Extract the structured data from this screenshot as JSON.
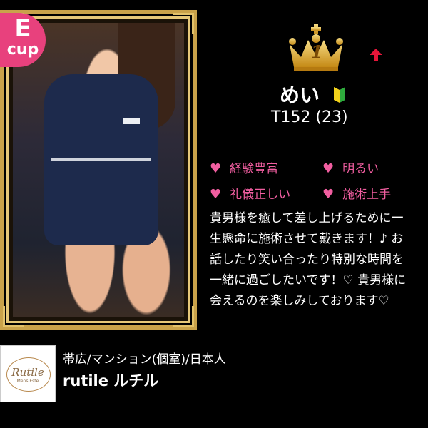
{
  "profile": {
    "cup": {
      "letter": "E",
      "unit": "cup"
    },
    "rank": {
      "number": "1",
      "trend": "up"
    },
    "name": "めい",
    "stats": "T152 (23)",
    "tags": [
      "経験豊富",
      "明るい",
      "礼儀正しい",
      "施術上手"
    ],
    "description": [
      "貴男様を癒して差し上げるために一",
      "生懸命に施術させて戴きます！♪ お",
      "話したり笑い合ったり特別な時間を",
      "一緒に過ごしたいです！♡ 貴男様に",
      "会えるのを楽しみしております♡"
    ]
  },
  "shop": {
    "area": "帯広/マンション(個室)/日本人",
    "name": "rutile ルチル",
    "logo_text": "Rutile",
    "logo_sub": "Mens Este"
  },
  "colors": {
    "accent_pink": "#f15ea0",
    "badge_pink": "#e8417d",
    "gold": "#c9a24a",
    "arrow_red": "#e6163a"
  }
}
